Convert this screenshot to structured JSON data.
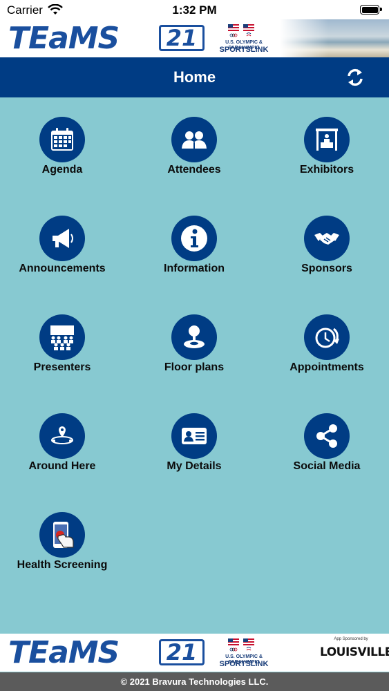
{
  "status_bar": {
    "carrier": "Carrier",
    "time": "1:32 PM"
  },
  "banner": {
    "logo_text": "TEaMS",
    "logo_number": "21",
    "olympic_line": "U.S. OLYMPIC & PARALYMPIC",
    "sportslink": "SPORTSLINK",
    "sponsor_small": "App Sponsored by",
    "sponsor_name": "LOUISVILLE"
  },
  "navbar": {
    "title": "Home",
    "refresh_icon": "refresh-icon"
  },
  "menu": [
    {
      "label": "Agenda",
      "icon": "calendar-icon"
    },
    {
      "label": "Attendees",
      "icon": "people-icon"
    },
    {
      "label": "Exhibitors",
      "icon": "booth-icon"
    },
    {
      "label": "Announcements",
      "icon": "megaphone-icon"
    },
    {
      "label": "Information",
      "icon": "info-icon"
    },
    {
      "label": "Sponsors",
      "icon": "handshake-icon"
    },
    {
      "label": "Presenters",
      "icon": "presenter-icon"
    },
    {
      "label": "Floor plans",
      "icon": "map-pin-icon"
    },
    {
      "label": "Appointments",
      "icon": "clock-icon"
    },
    {
      "label": "Around Here",
      "icon": "location-icon"
    },
    {
      "label": "My Details",
      "icon": "id-card-icon"
    },
    {
      "label": "Social Media",
      "icon": "share-icon"
    },
    {
      "label": "Health Screening",
      "icon": "phone-touch-icon"
    }
  ],
  "footer": {
    "copyright": "© 2021 Bravura Technologies LLC."
  },
  "colors": {
    "background": "#87c9d1",
    "navbar": "#003c84",
    "icon_circle": "#003c84",
    "footer": "#5b5b5b"
  }
}
